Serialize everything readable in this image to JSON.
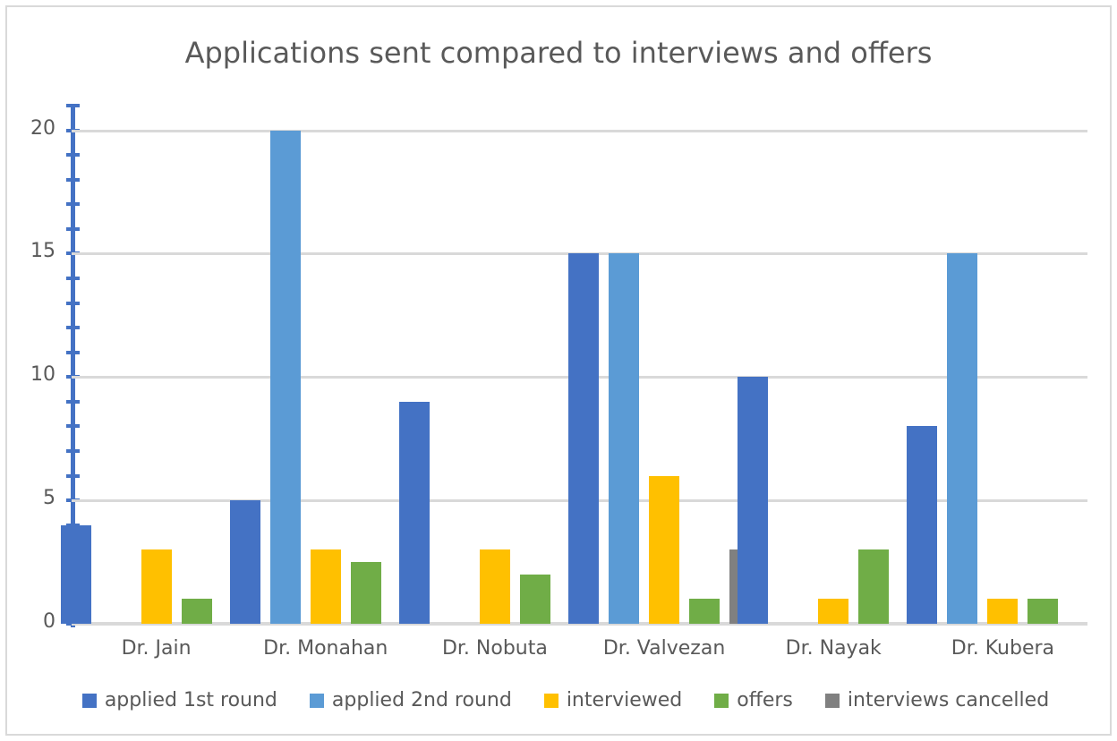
{
  "chart_data": {
    "type": "bar",
    "title": "Applications sent compared to interviews and offers",
    "xlabel": "",
    "ylabel": "",
    "ylim": [
      0,
      21
    ],
    "yticks": [
      0,
      5,
      10,
      15,
      20
    ],
    "ytick_labels": [
      "0",
      "5",
      "10",
      "15",
      "20"
    ],
    "minor_tick_interval": 1,
    "grid": "horizontal",
    "legend_position": "bottom",
    "categories": [
      "Dr. Jain",
      "Dr. Monahan",
      "Dr. Nobuta",
      "Dr. Valvezan",
      "Dr. Nayak",
      "Dr. Kubera"
    ],
    "series": [
      {
        "name": "applied 1st round",
        "color": "#4472c4",
        "values": [
          4,
          5,
          9,
          15,
          10,
          8
        ]
      },
      {
        "name": "applied 2nd round",
        "color": "#5b9bd5",
        "values": [
          0,
          20,
          0,
          15,
          0,
          15
        ]
      },
      {
        "name": "interviewed",
        "color": "#ffc000",
        "values": [
          3,
          3,
          3,
          6,
          1,
          1
        ]
      },
      {
        "name": "offers",
        "color": "#70ad47",
        "values": [
          1,
          2.5,
          2,
          1,
          3,
          1
        ]
      },
      {
        "name": "interviews cancelled",
        "color": "#808080",
        "values": [
          0,
          0,
          0,
          3,
          0,
          0
        ]
      }
    ]
  },
  "style": {
    "axis_selected_color": "#4472c4",
    "gridline_color": "#d9d9d9",
    "text_color": "#595959",
    "frame_color": "#d9d9d9",
    "background": "#ffffff"
  }
}
